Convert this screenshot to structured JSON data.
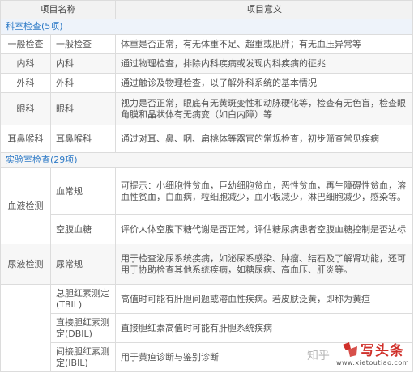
{
  "header": {
    "col_name": "项目名称",
    "col_meaning": "项目意义"
  },
  "section1": {
    "title": "科室检查(5项)",
    "rows": [
      {
        "category": "一般检查",
        "name": "一般检查",
        "meaning": "体重是否正常，有无体重不足、超重或肥胖；有无血压异常等"
      },
      {
        "category": "内科",
        "name": "内科",
        "meaning": "通过物理检查，排除内科疾病或发现内科疾病的征兆"
      },
      {
        "category": "外科",
        "name": "外科",
        "meaning": "通过触诊及物理检查，以了解外科系统的基本情况"
      },
      {
        "category": "眼科",
        "name": "眼科",
        "meaning": "视力是否正常，眼底有无黄斑变性和动脉硬化等，检查有无色盲，检查眼角膜和晶状体有无病变（如白内障）等"
      },
      {
        "category": "耳鼻喉科",
        "name": "耳鼻喉科",
        "meaning": "通过对耳、鼻、咽、扁桃体等器官的常规检查，初步筛查常见疾病"
      }
    ]
  },
  "section2": {
    "title": "实验室检查(29项)",
    "blood": {
      "category": "血液检测",
      "rows": [
        {
          "name": "血常规",
          "meaning": "可提示：小细胞性贫血，巨幼细胞贫血，恶性贫血，再生障碍性贫血，溶血性贫血，白血病，粒细胞减少，血小板减少，淋巴细胞减少，感染等。"
        },
        {
          "name": "空腹血糖",
          "meaning": "评价人体空腹下糖代谢是否正常，评估糖尿病患者空腹血糖控制是否达标"
        }
      ]
    },
    "urine": {
      "category": "尿液检测",
      "rows": [
        {
          "name": "尿常规",
          "meaning": "用于检查泌尿系统疾病，如泌尿系感染、肿瘤、结石及了解肾功能，还可用于协助检查其他系统疾病，如糖尿病、高血压、肝炎等。"
        }
      ]
    },
    "liver": {
      "rows": [
        {
          "name": "总胆红素测定(TBIL)",
          "meaning": "高值时可能有肝胆问题或溶血性疾病。若皮肤泛黄，即称为黄疸"
        },
        {
          "name": "直接胆红素测定(DBIL)",
          "meaning": "直接胆红素高值时可能有肝胆系统疾病"
        },
        {
          "name": "间接胆红素测定(IBIL)",
          "meaning": "用于黄疸诊断与鉴别诊断"
        }
      ]
    }
  },
  "watermark": {
    "zhihu": "知乎",
    "brand": "写头条",
    "url": "www.xietoutiao.com"
  },
  "colors": {
    "section_text": "#2f7bc7",
    "brand_red": "#d0302a",
    "border": "#dcdcdc"
  }
}
